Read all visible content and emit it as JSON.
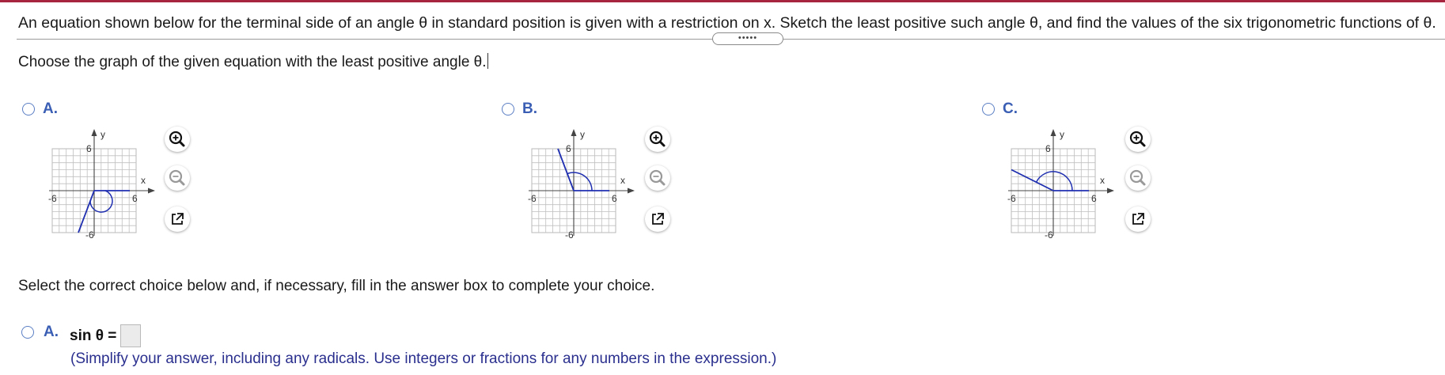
{
  "problem_text": "An equation shown below for the terminal side of an angle θ in standard position is given with a restriction on x. Sketch the least positive such angle θ, and find the values of the six trigonometric functions of θ.",
  "expand_button_label": "•••••",
  "instruction": "Choose the graph of the given equation with the least positive angle θ.",
  "choices": [
    {
      "letter": "A.",
      "axis_x": "x",
      "axis_y": "y",
      "tick_pos": "6",
      "tick_neg": "-6",
      "tick_top": "6",
      "tick_bottom": "-6"
    },
    {
      "letter": "B.",
      "axis_x": "x",
      "axis_y": "y",
      "tick_pos": "6",
      "tick_neg": "-6",
      "tick_top": "6",
      "tick_bottom": "-6"
    },
    {
      "letter": "C.",
      "axis_x": "x",
      "axis_y": "y",
      "tick_pos": "6",
      "tick_neg": "-6",
      "tick_top": "6",
      "tick_bottom": "-6"
    }
  ],
  "select_prompt": "Select the correct choice below and, if necessary, fill in the answer box to complete your choice.",
  "answer_choice": {
    "letter": "A.",
    "label": "sin θ =",
    "value": "",
    "hint": "(Simplify your answer, including any radicals. Use integers or fractions for any numbers in the expression.)"
  },
  "colors": {
    "accent_bar": "#a8253f",
    "radio": "#5b7fc4",
    "letter": "#3a5eb4",
    "hint": "#2a2f8e",
    "graph_line": "#1f2fb0"
  },
  "icons": [
    "zoom-in-icon",
    "zoom-out-icon",
    "pop-out-icon"
  ]
}
